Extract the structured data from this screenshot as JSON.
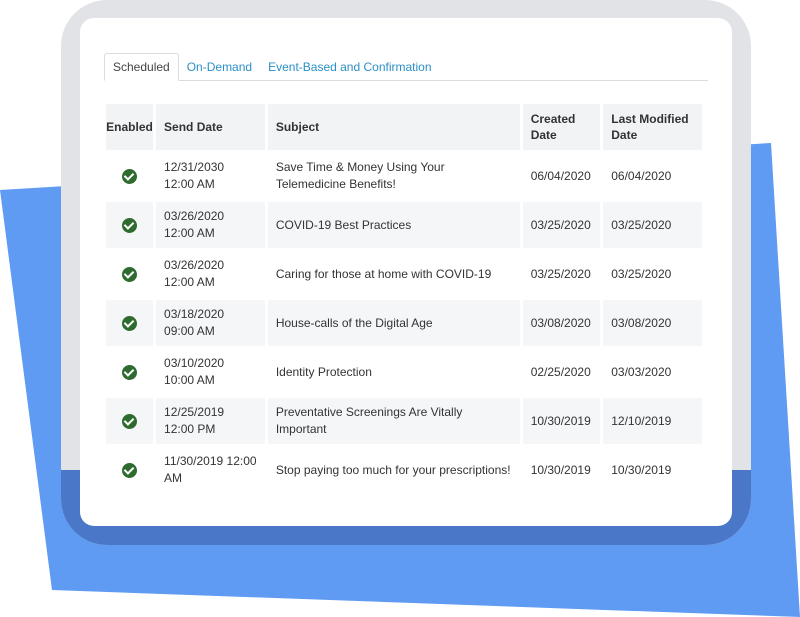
{
  "colors": {
    "backdrop_blue": "#5f9bf2",
    "device_frame": "#e2e3e6",
    "device_shadow": "#4a77c7",
    "tab_link": "#2b8fc7",
    "check_green": "#2e6b2f"
  },
  "tabs": [
    {
      "label": "Scheduled",
      "active": true
    },
    {
      "label": "On-Demand",
      "active": false
    },
    {
      "label": "Event-Based and Confirmation",
      "active": false
    }
  ],
  "table": {
    "headers": {
      "enabled": "Enabled",
      "send_date": "Send Date",
      "subject": "Subject",
      "created_date": "Created Date",
      "last_modified_date": "Last Modified Date"
    },
    "rows": [
      {
        "enabled_icon": "check-circle-icon",
        "send_date": "12/31/2030 12:00 AM",
        "subject": "Save Time & Money Using Your Telemedicine Benefits!",
        "created": "06/04/2020",
        "modified": "06/04/2020"
      },
      {
        "enabled_icon": "check-circle-icon",
        "send_date": "03/26/2020 12:00 AM",
        "subject": "COVID-19 Best Practices",
        "created": "03/25/2020",
        "modified": "03/25/2020"
      },
      {
        "enabled_icon": "check-circle-icon",
        "send_date": "03/26/2020 12:00 AM",
        "subject": "Caring for those at home with COVID-19",
        "created": "03/25/2020",
        "modified": "03/25/2020"
      },
      {
        "enabled_icon": "check-circle-icon",
        "send_date": "03/18/2020 09:00 AM",
        "subject": "House-calls of the Digital Age",
        "created": "03/08/2020",
        "modified": "03/08/2020"
      },
      {
        "enabled_icon": "check-circle-icon",
        "send_date": "03/10/2020 10:00 AM",
        "subject": "Identity Protection",
        "created": "02/25/2020",
        "modified": "03/03/2020"
      },
      {
        "enabled_icon": "check-circle-icon",
        "send_date": "12/25/2019 12:00 PM",
        "subject": "Preventative Screenings Are Vitally Important",
        "created": "10/30/2019",
        "modified": "12/10/2019"
      },
      {
        "enabled_icon": "check-circle-icon",
        "send_date": "11/30/2019 12:00 AM",
        "subject": "Stop paying too much for your prescriptions!",
        "created": "10/30/2019",
        "modified": "10/30/2019"
      }
    ]
  }
}
